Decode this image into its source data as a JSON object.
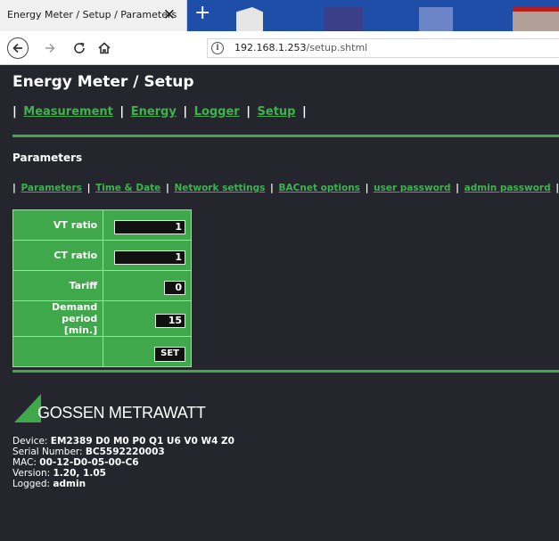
{
  "browser": {
    "tab_title": "Energy Meter / Setup / Parameters",
    "close_glyph": "✕",
    "newtab_glyph": "+",
    "url_host": "192.168.1.253",
    "url_path": "/setup.shtml",
    "info_glyph": "i"
  },
  "page": {
    "title": "Energy Meter / Setup",
    "main_nav": {
      "measurement": "Measurement",
      "energy": "Energy",
      "logger": "Logger",
      "setup": "Setup"
    },
    "section_title": "Parameters",
    "sub_nav": {
      "parameters": "Parameters",
      "time_date": "Time & Date",
      "network": "Network settings",
      "bacnet": "BACnet options",
      "user_password": "user password",
      "admin_password": "admin password"
    },
    "params": {
      "vt_label": "VT ratio",
      "vt_value": "1",
      "ct_label": "CT ratio",
      "ct_value": "1",
      "tariff_label": "Tariff",
      "tariff_value": "0",
      "demand_label_line1": "Demand period",
      "demand_label_line2": "[min.]",
      "demand_value": "15",
      "set_label": "SET"
    },
    "logo_text": "GOSSEN METRAWATT",
    "device_info": {
      "device_label": "Device: ",
      "device_value": "EM2389 D0 M0 P0 Q1 U6 V0 W4 Z0",
      "serial_label": "Serial Number: ",
      "serial_value": "BC5592220003",
      "mac_label": "MAC: ",
      "mac_value": "00-12-D0-05-00-C6",
      "version_label": "Version: ",
      "version_value": "1.20, 1.05",
      "logged_label": "Logged: ",
      "logged_value": "admin"
    }
  },
  "colors": {
    "background": "#25252d",
    "accent_green": "#3ea84a",
    "link_green": "#3fb24f",
    "tabbar_blue": "#1f4ea8"
  },
  "icons": [
    "back-arrow-icon",
    "forward-arrow-icon",
    "reload-icon",
    "home-icon",
    "info-icon",
    "close-icon",
    "plus-icon",
    "logo-triangle-icon"
  ]
}
